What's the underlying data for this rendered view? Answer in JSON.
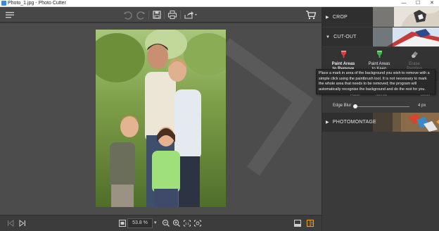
{
  "window": {
    "title": "Photo_1.jpg - Photo Cutter",
    "minimize": "—",
    "maximize": "☐",
    "close": "✕"
  },
  "toolbar": {
    "menu_icon": "hamburger-menu-icon",
    "undo_icon": "undo-icon",
    "redo_icon": "redo-icon",
    "save_icon": "save-icon",
    "print_icon": "print-icon",
    "share_icon": "share-icon",
    "cart_icon": "cart-icon"
  },
  "bottom": {
    "zoom_value": "53.8 %",
    "zoom_dropdown": "▾"
  },
  "panel": {
    "sections": {
      "crop": "CROP",
      "cutout": "CUT-OUT",
      "photomontage": "PHOTOMONTAGE"
    },
    "tools": [
      {
        "label_line1": "Paint Areas",
        "label_line2": "to Remove",
        "icon": "red-paintbrush-icon",
        "color": "#e0393a"
      },
      {
        "label_line1": "Paint Areas",
        "label_line2": "to Keep",
        "icon": "green-paintbrush-icon",
        "color": "#3bb54a"
      },
      {
        "label_line1": "Erase",
        "label_line2": "Painting",
        "icon": "eraser-icon",
        "color": "#8a8a8a"
      }
    ],
    "tooltip": "Place a mark in area of the background you wish to remove with a simple click using the paintbrush tool. It is not necessary to mark the whole area that needs to be removed; the program will automatically recognise the background and do the rest for you.",
    "brush_row": {
      "left": "Faster",
      "middle": "Normal",
      "right": "Better"
    },
    "edge_blur": {
      "label": "Edge Blur",
      "value": "4 px",
      "level": 0
    }
  },
  "colors": {
    "panel_bg": "#3a3a3a",
    "workspace_bg": "#4c4c4c",
    "toolbar_bg": "#474747",
    "accent_orange": "#f39a1e"
  }
}
